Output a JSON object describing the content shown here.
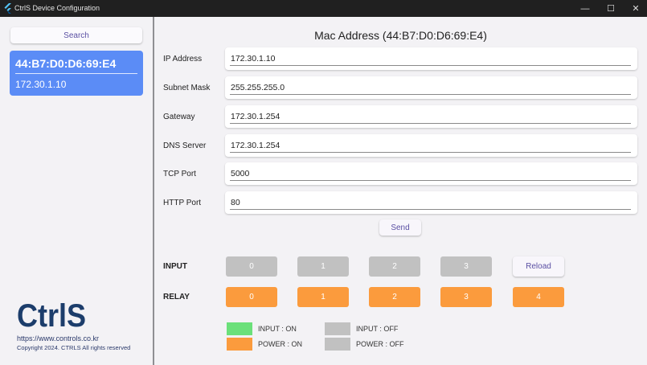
{
  "window": {
    "title": "CtrlS Device Configuration",
    "minimize_glyph": "—",
    "maximize_glyph": "☐",
    "close_glyph": "✕",
    "icon": "flutter-icon"
  },
  "sidebar": {
    "search_label": "Search",
    "device": {
      "mac": "44:B7:D0:D6:69:E4",
      "ip": "172.30.1.10"
    },
    "logo_text": "CtrlS",
    "url": "https://www.controls.co.kr",
    "copyright": "Copyright 2024. CTRLS All rights reserved"
  },
  "main": {
    "title": "Mac Address (44:B7:D0:D6:69:E4)",
    "fields": [
      {
        "label": "IP Address",
        "value": "172.30.1.10"
      },
      {
        "label": "Subnet Mask",
        "value": "255.255.255.0"
      },
      {
        "label": "Gateway",
        "value": "172.30.1.254"
      },
      {
        "label": "DNS Server",
        "value": "172.30.1.254"
      },
      {
        "label": "TCP Port",
        "value": "5000"
      },
      {
        "label": "HTTP Port",
        "value": "80"
      }
    ],
    "send_label": "Send",
    "input": {
      "label": "INPUT",
      "buttons": [
        "0",
        "1",
        "2",
        "3"
      ],
      "reload_label": "Reload"
    },
    "relay": {
      "label": "RELAY",
      "buttons": [
        "0",
        "1",
        "2",
        "3",
        "4"
      ]
    },
    "legend": [
      {
        "label": "INPUT : ON",
        "color": "#6be07a"
      },
      {
        "label": "INPUT : OFF",
        "color": "#c1c1c1"
      },
      {
        "label": "POWER : ON",
        "color": "#fb9b3d"
      },
      {
        "label": "POWER : OFF",
        "color": "#c1c1c1"
      }
    ]
  },
  "colors": {
    "accent": "#5b8cf6",
    "relay_on": "#fb9b3d",
    "input_off": "#c1c1c1",
    "button_text": "#5a4fa3"
  }
}
